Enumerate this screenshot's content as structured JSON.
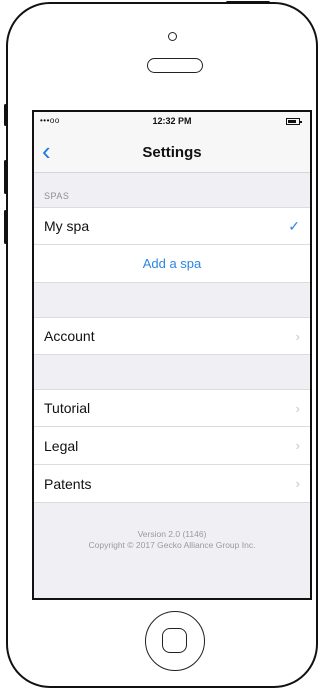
{
  "status_bar": {
    "signal": "•••oo",
    "time": "12:32 PM"
  },
  "nav": {
    "back_icon": "chevron-left-icon",
    "title": "Settings"
  },
  "spas": {
    "header": "SPAS",
    "items": [
      {
        "label": "My spa",
        "selected": true
      }
    ],
    "add_label": "Add a spa"
  },
  "account_group": [
    {
      "label": "Account"
    }
  ],
  "info_group": [
    {
      "label": "Tutorial"
    },
    {
      "label": "Legal"
    },
    {
      "label": "Patents"
    }
  ],
  "footer": {
    "version": "Version 2.0 (1146)",
    "copyright": "Copyright © 2017 Gecko Alliance Group Inc."
  },
  "colors": {
    "accent": "#2b86e3",
    "background": "#efeff4"
  }
}
